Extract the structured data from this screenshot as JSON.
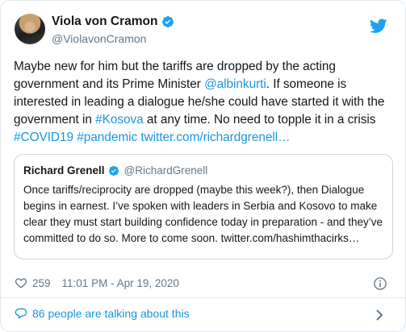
{
  "author": {
    "name": "Viola von Cramon",
    "handle": "@ViolavonCramon"
  },
  "tweet": {
    "text_1": "Maybe new for him but the tariffs are dropped by the acting government and its Prime Minister ",
    "mention": "@albinkurti",
    "text_2": ". If someone is interested in leading a dialogue he/she could have started it with the government in ",
    "hashtag_kosova": "#Kosova",
    "text_3": " at any time. No need to topple it in a crisis ",
    "hashtag_covid": "#COVID19",
    "space": " ",
    "hashtag_pandemic": "#pandemic",
    "link": "twitter.com/richardgrenell…"
  },
  "quoted": {
    "name": "Richard Grenell",
    "handle": "@RichardGrenell",
    "text": "Once tariffs/reciprocity are dropped (maybe this week?), then Dialogue begins in earnest. I’ve spoken with leaders in Serbia and Kosovo to make clear they must start building confidence today in preparation - and they’ve committed to do so. More to come soon. twitter.com/hashimthacirks…"
  },
  "meta": {
    "likes": "259",
    "timestamp": "11:01 PM - Apr 19, 2020"
  },
  "footer": {
    "talking": "86 people are talking about this"
  },
  "icons": {
    "verified": "verified-badge-icon",
    "bird": "twitter-bird-icon",
    "heart": "heart-icon",
    "info": "info-icon",
    "bubble": "speech-bubble-icon",
    "chevron": "chevron-right-icon"
  },
  "colors": {
    "link": "#1b95e0",
    "secondary_text": "#657786",
    "border": "#e1e8ed"
  }
}
